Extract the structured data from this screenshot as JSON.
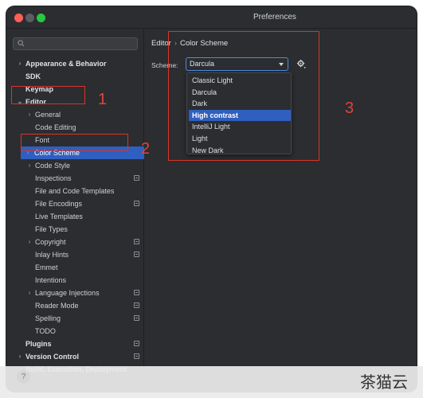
{
  "window": {
    "title": "Preferences"
  },
  "sidebar": {
    "search_placeholder": "",
    "items": [
      {
        "label": "Appearance & Behavior",
        "arrow": "›",
        "bold": true
      },
      {
        "label": "SDK",
        "arrow": "",
        "bold": true
      },
      {
        "label": "Keymap",
        "arrow": "",
        "bold": true
      },
      {
        "label": "Editor",
        "arrow": "⌄",
        "bold": true
      },
      {
        "label": "General",
        "arrow": "›",
        "bold": false
      },
      {
        "label": "Code Editing",
        "arrow": "",
        "bold": false
      },
      {
        "label": "Font",
        "arrow": "",
        "bold": false
      },
      {
        "label": "Color Scheme",
        "arrow": "›",
        "bold": false,
        "selected": true
      },
      {
        "label": "Code Style",
        "arrow": "›",
        "bold": false
      },
      {
        "label": "Inspections",
        "arrow": "",
        "bold": false,
        "badge": true
      },
      {
        "label": "File and Code Templates",
        "arrow": "",
        "bold": false
      },
      {
        "label": "File Encodings",
        "arrow": "",
        "bold": false,
        "badge": true
      },
      {
        "label": "Live Templates",
        "arrow": "",
        "bold": false
      },
      {
        "label": "File Types",
        "arrow": "",
        "bold": false
      },
      {
        "label": "Copyright",
        "arrow": "›",
        "bold": false,
        "badge": true
      },
      {
        "label": "Inlay Hints",
        "arrow": "",
        "bold": false,
        "badge": true
      },
      {
        "label": "Emmet",
        "arrow": "",
        "bold": false
      },
      {
        "label": "Intentions",
        "arrow": "",
        "bold": false
      },
      {
        "label": "Language Injections",
        "arrow": "›",
        "bold": false,
        "badge": true
      },
      {
        "label": "Reader Mode",
        "arrow": "",
        "bold": false,
        "badge": true
      },
      {
        "label": "Spelling",
        "arrow": "",
        "bold": false,
        "badge": true
      },
      {
        "label": "TODO",
        "arrow": "",
        "bold": false
      },
      {
        "label": "Plugins",
        "arrow": "",
        "bold": true,
        "badge": true
      },
      {
        "label": "Version Control",
        "arrow": "›",
        "bold": true,
        "badge": true
      },
      {
        "label": "Build, Execution, Deployment",
        "arrow": "›",
        "bold": true
      }
    ]
  },
  "main": {
    "breadcrumb": [
      "Editor",
      "Color Scheme"
    ],
    "breadcrumb_sep": "›",
    "scheme_label": "Scheme:",
    "scheme_value": "Darcula",
    "dropdown_options": [
      "Classic Light",
      "Darcula",
      "Dark",
      "High contrast",
      "IntelliJ Light",
      "Light",
      "New Dark"
    ],
    "dropdown_highlighted": "High contrast"
  },
  "annotations": {
    "label_1": "1",
    "label_2": "2",
    "label_3": "3",
    "color": "#d9342b"
  },
  "footer": {
    "help_label": "?",
    "watermark": "茶猫云"
  }
}
